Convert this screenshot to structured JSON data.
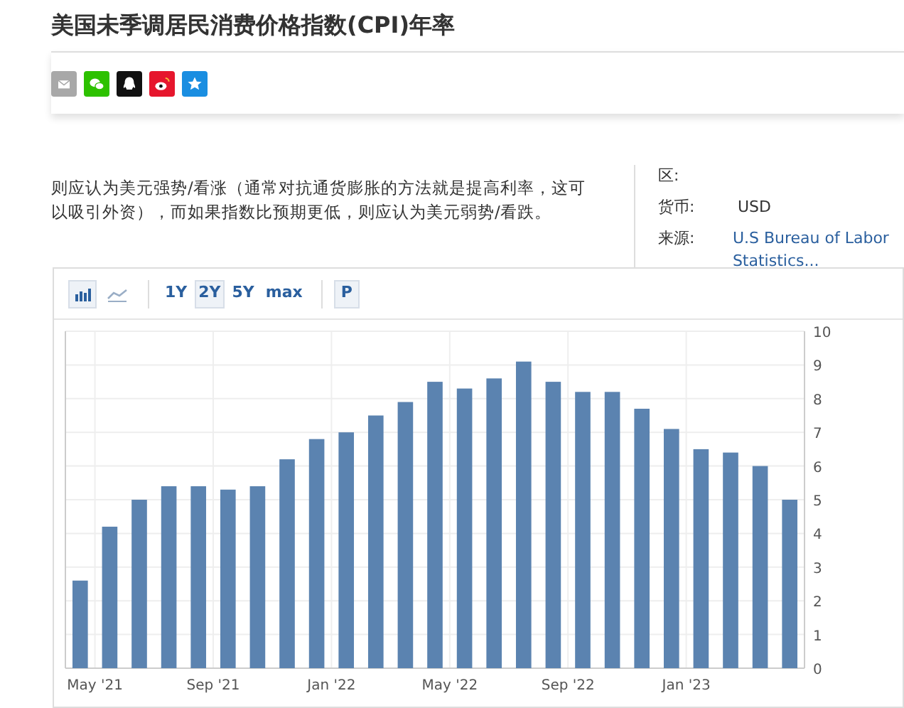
{
  "title": "美国未季调居民消费价格指数(CPI)年率",
  "share_buttons": [
    {
      "kind": "email",
      "color": "#a8a8a8"
    },
    {
      "kind": "wechat",
      "color": "#2dc100"
    },
    {
      "kind": "qq",
      "color": "#111111"
    },
    {
      "kind": "weibo",
      "color": "#e6162d"
    },
    {
      "kind": "favorite",
      "color": "#1a8ee1"
    }
  ],
  "description": "则应认为美元强势/看涨（通常对抗通货膨胀的方法就是提高利率，这可以吸引外资），而如果指数比预期更低，则应认为美元弱势/看跌。",
  "info": [
    {
      "label": "区:",
      "kind": "text"
    },
    {
      "label": "货币:",
      "value": "USD",
      "kind": "text"
    },
    {
      "label": "来源:",
      "value": "U.S Bureau of Labor Statistics...",
      "kind": "link"
    }
  ],
  "chart_toolbar": {
    "types": [
      {
        "kind": "bar",
        "selected": true
      },
      {
        "kind": "line",
        "selected": false
      }
    ],
    "ranges": [
      {
        "label": "1Y",
        "selected": false
      },
      {
        "label": "2Y",
        "selected": true
      },
      {
        "label": "5Y",
        "selected": false
      },
      {
        "label": "max",
        "selected": false
      }
    ],
    "extra": [
      {
        "label": "P",
        "selected": false
      }
    ]
  },
  "chart_data": {
    "type": "bar",
    "categories": [
      null,
      "May '21",
      null,
      null,
      null,
      "Sep '21",
      null,
      null,
      null,
      "Jan '22",
      null,
      null,
      null,
      "May '22",
      null,
      null,
      null,
      "Sep '22",
      null,
      null,
      null,
      "Jan '23",
      null,
      null,
      null
    ],
    "series": [
      {
        "color": "#5b83b0",
        "values": [
          2.6,
          4.2,
          5.0,
          5.4,
          5.4,
          5.3,
          5.4,
          6.2,
          6.8,
          7.0,
          7.5,
          7.9,
          8.5,
          8.3,
          8.6,
          9.1,
          8.5,
          8.2,
          8.2,
          7.7,
          7.1,
          6.5,
          6.4,
          6.0,
          5.0
        ]
      }
    ],
    "grid": true,
    "ylim": [
      0,
      10
    ],
    "yticks": [
      0,
      1,
      2,
      3,
      4,
      5,
      6,
      7,
      8,
      9,
      10
    ]
  }
}
